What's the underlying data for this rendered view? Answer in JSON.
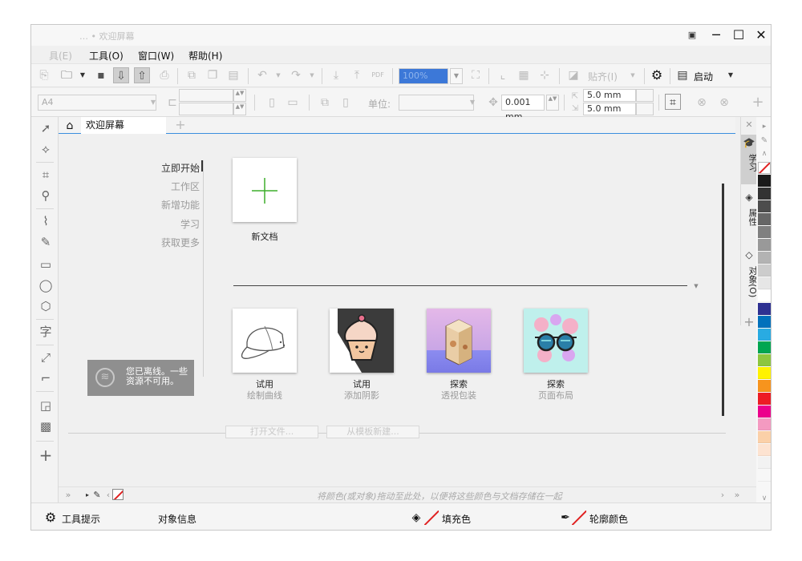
{
  "window": {
    "title": "… • 欢迎屏幕",
    "controls": [
      "─",
      "☐",
      "✕"
    ]
  },
  "menu": {
    "items": [
      "具(E)",
      "工具(O)",
      "窗口(W)",
      "帮助(H)"
    ]
  },
  "toolbar": {
    "zoom_value": "100%",
    "snap_label": "贴齐(I)",
    "launch_label": "启动"
  },
  "property_bar": {
    "page_size": "A4",
    "unit_label": "单位:",
    "nudge_value": "0.001 mm",
    "dup_x": "5.0 mm",
    "dup_y": "5.0 mm"
  },
  "tabs": {
    "welcome_label": "欢迎屏幕"
  },
  "welcome_nav": {
    "items": [
      "立即开始",
      "工作区",
      "新增功能",
      "学习",
      "获取更多"
    ],
    "active_index": 0
  },
  "offline_notice": {
    "line1": "您已离线。一些",
    "line2": "资源不可用。"
  },
  "new_document": {
    "label": "新文档"
  },
  "cards": [
    {
      "title": "试用",
      "subtitle": "绘制曲线"
    },
    {
      "title": "试用",
      "subtitle": "添加阴影"
    },
    {
      "title": "探索",
      "subtitle": "透视包装"
    },
    {
      "title": "探索",
      "subtitle": "页面布局"
    }
  ],
  "buttons": {
    "open_file": "打开文件...",
    "from_template": "从模板新建..."
  },
  "docker_tabs": [
    "学习",
    "属性",
    "对象(O)"
  ],
  "palette_colors": [
    "#ffffff",
    "#1a1a1a",
    "#333333",
    "#4d4d4d",
    "#666666",
    "#808080",
    "#999999",
    "#b3b3b3",
    "#cccccc",
    "#e6e6e6",
    "#ffffff",
    "#2e3192",
    "#0071bc",
    "#29abe2",
    "#00a651",
    "#8dc63f",
    "#fff200",
    "#f7941d",
    "#ed1c24",
    "#ec008c",
    "#f49ac1",
    "#fbd0a8",
    "#fde3d1",
    "#f2f2f2",
    "#f7f7f7"
  ],
  "color_bar": {
    "hint": "将颜色(或对象)拖动至此处，以便将这些颜色与文档存储在一起"
  },
  "status": {
    "tool_hint": "工具提示",
    "object_info": "对象信息",
    "fill_label": "填充色",
    "outline_label": "轮廓颜色"
  }
}
